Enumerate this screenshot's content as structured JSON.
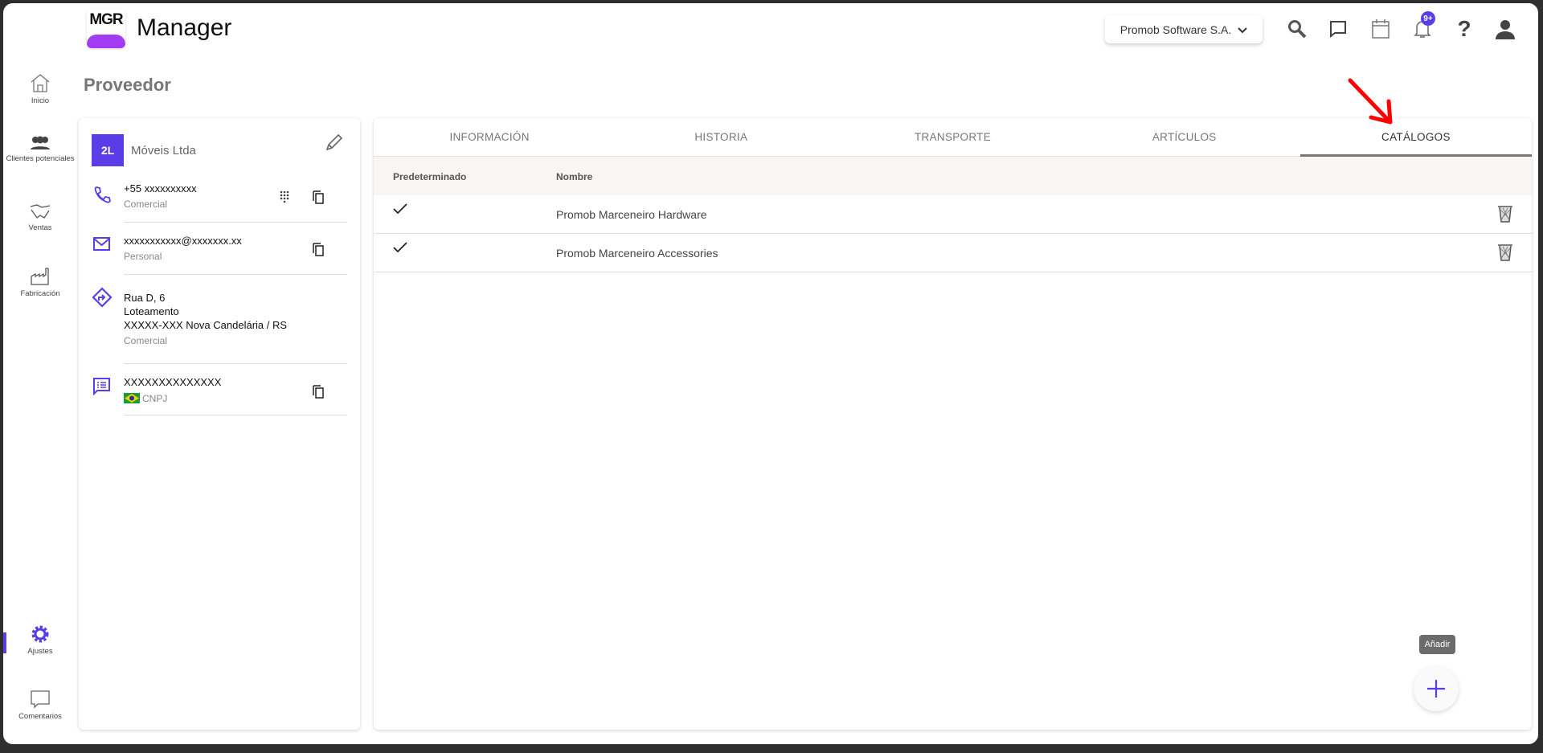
{
  "header": {
    "logo_text": "MGR",
    "app_name": "Manager",
    "company": "Promob Software S.A.",
    "notification_badge": "9+"
  },
  "sidebar": {
    "items": [
      {
        "label": "Inicio"
      },
      {
        "label": "Clientes potenciales"
      },
      {
        "label": "Ventas"
      },
      {
        "label": "Fabricación"
      },
      {
        "label": "Ajustes"
      },
      {
        "label": "Comentarios"
      }
    ]
  },
  "page_title": "Proveedor",
  "supplier": {
    "initials": "2L",
    "name": "Móveis Ltda",
    "phone": {
      "value": "+55 xxxxxxxxxx",
      "type": "Comercial"
    },
    "email": {
      "value": "xxxxxxxxxxx@xxxxxxx.xx",
      "type": "Personal"
    },
    "address": {
      "line1": "Rua D, 6",
      "line2": "Loteamento",
      "line3": "XXXXX-XXX Nova Candelária / RS",
      "type": "Comercial"
    },
    "document": {
      "value": "XXXXXXXXXXXXXX",
      "type": "CNPJ"
    }
  },
  "tabs": [
    {
      "label": "INFORMACIÓN"
    },
    {
      "label": "HISTORIA"
    },
    {
      "label": "TRANSPORTE"
    },
    {
      "label": "ARTÍCULOS"
    },
    {
      "label": "CATÁLOGOS"
    }
  ],
  "table": {
    "columns": [
      "Predeterminado",
      "Nombre"
    ],
    "rows": [
      {
        "default": true,
        "name": "Promob Marceneiro Hardware"
      },
      {
        "default": true,
        "name": "Promob Marceneiro Accessories"
      }
    ]
  },
  "add_tooltip": "Añadir",
  "colors": {
    "accent": "#5b3de8",
    "annotation": "#ff0000"
  }
}
